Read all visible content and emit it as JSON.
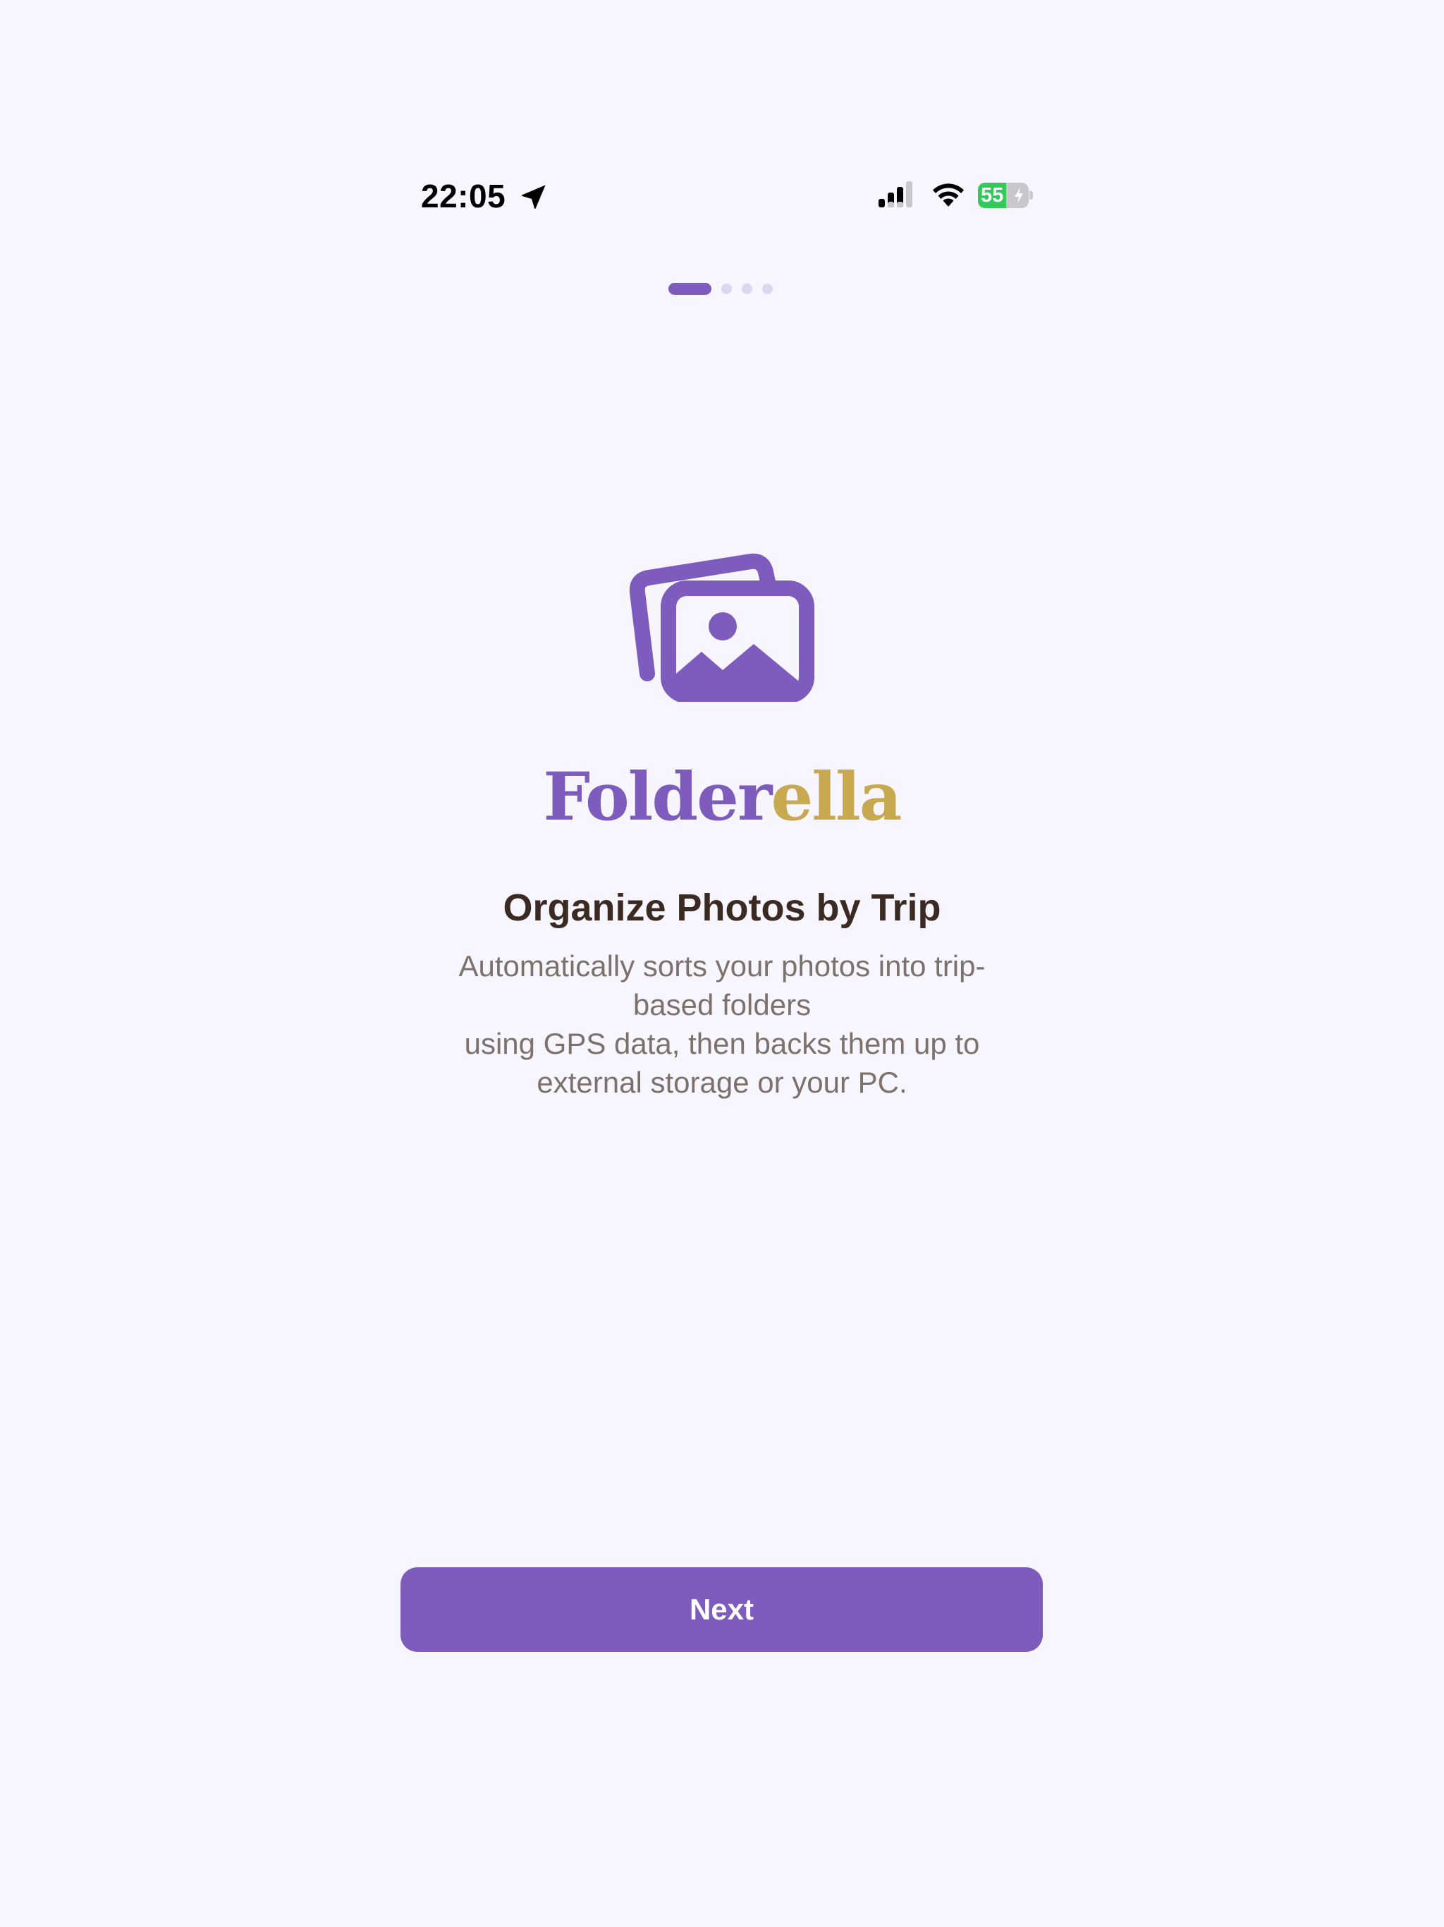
{
  "status_bar": {
    "time": "22:05",
    "battery_level": "55",
    "battery_fraction": 0.55,
    "icons": [
      "location-arrow-icon",
      "cellular-signal-icon",
      "wifi-icon",
      "battery-charging-icon"
    ]
  },
  "onboarding": {
    "page_count": 4,
    "current_page": 1,
    "hero_icon": "photos-stack-icon",
    "logo": {
      "part_1": "Folder",
      "part_2": "ella"
    },
    "headline": "Organize Photos by Trip",
    "description_lines": [
      "Automatically sorts your photos into trip-",
      "based folders",
      "using GPS data, then backs them up to",
      "external storage or your PC."
    ],
    "next_label": "Next"
  },
  "colors": {
    "background": "#F7F5FD",
    "accent_purple": "#7E5CBD",
    "accent_gold": "#C9A94F",
    "headline": "#3A2A22",
    "body_text": "#7D716C",
    "dot_inactive": "#DCD6EE",
    "battery_green": "#34C759"
  }
}
